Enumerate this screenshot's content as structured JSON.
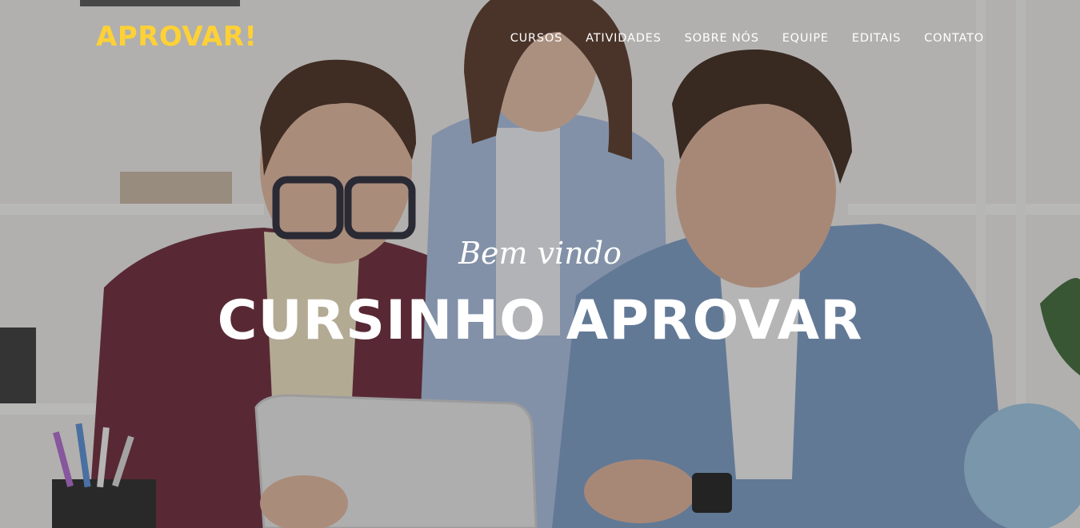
{
  "brand": {
    "title": "APROVAR!"
  },
  "nav": {
    "items": [
      {
        "label": "CURSOS"
      },
      {
        "label": "ATIVIDADES"
      },
      {
        "label": "SOBRE NÓS"
      },
      {
        "label": "EQUIPE"
      },
      {
        "label": "EDITAIS"
      },
      {
        "label": "CONTATO"
      }
    ]
  },
  "hero": {
    "lead_in": "Bem vindo",
    "heading": "CURSINHO APROVAR"
  },
  "colors": {
    "brand_accent": "#fed136",
    "text": "#ffffff"
  }
}
